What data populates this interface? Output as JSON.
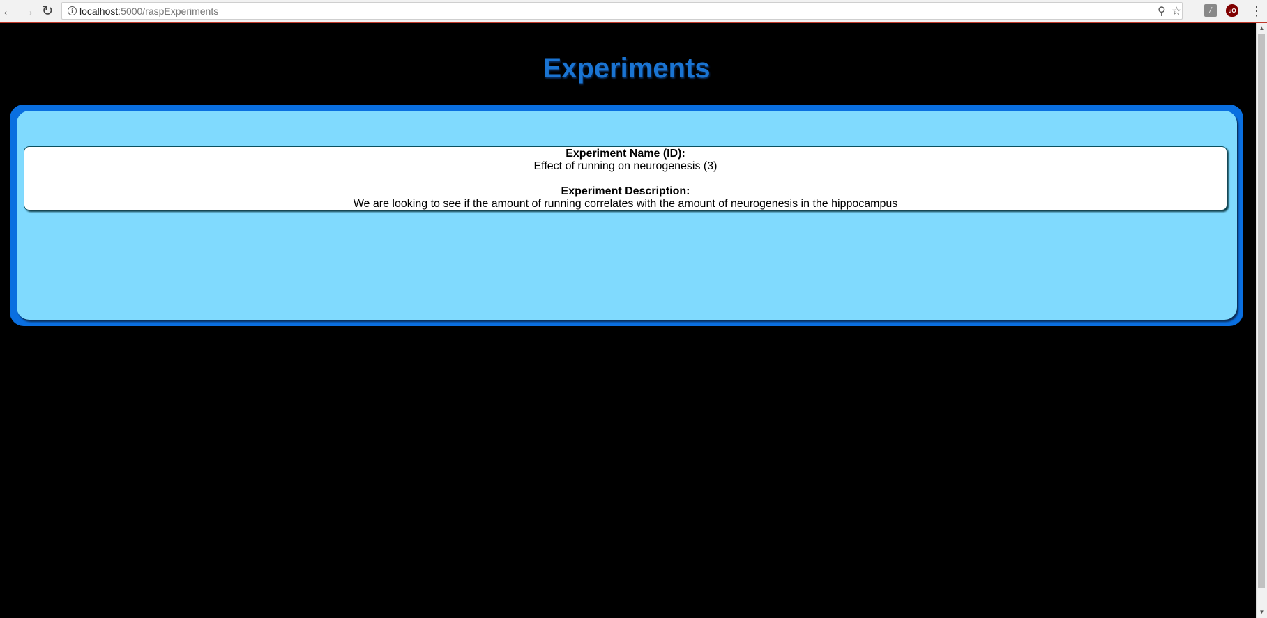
{
  "browser": {
    "url_host": "localhost",
    "url_rest": ":5000/raspExperiments",
    "icons": {
      "back": "back-arrow-icon",
      "forward": "forward-arrow-icon",
      "reload": "reload-icon",
      "info": "info-icon",
      "key": "key-icon",
      "star": "bookmark-star-icon",
      "ext1": "adblock-extension-icon",
      "ext2": "ublock-extension-icon",
      "menu": "kebab-menu-icon"
    },
    "ext_ub_label": "uO"
  },
  "page": {
    "title": "Experiments",
    "title_color": "#1a74d2",
    "background": "#000000",
    "panel_outer_color": "#0a6fe0",
    "panel_inner_color": "#80dafe"
  },
  "experiments": [
    {
      "name_label": "Experiment Name (ID):",
      "name_value": "Effect of running on neurogenesis (3)",
      "description_label": "Experiment Description:",
      "description_value": "We are looking to see if the amount of running correlates with the amount of neurogenesis in the hippocampus"
    }
  ]
}
